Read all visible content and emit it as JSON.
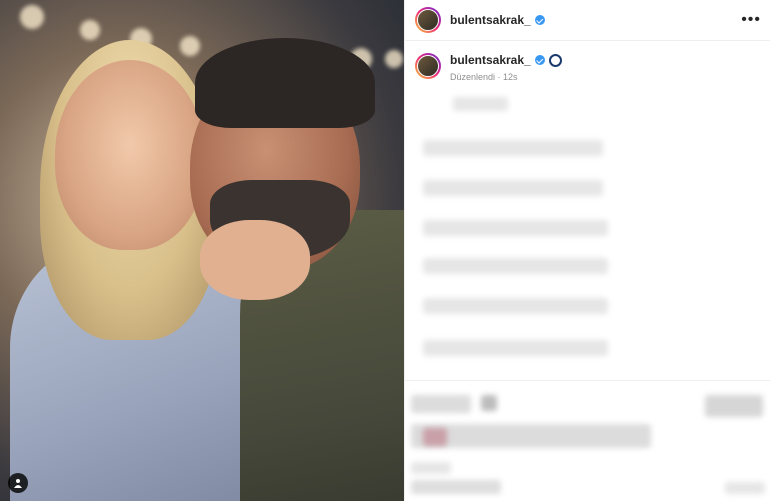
{
  "post": {
    "username": "bulentsakrak_",
    "caption_meta": "Düzenlendi · 12s",
    "more_label": "•••"
  },
  "colors": {
    "verified": "#3897f0",
    "text": "#262626",
    "meta": "#8e8e8e"
  }
}
